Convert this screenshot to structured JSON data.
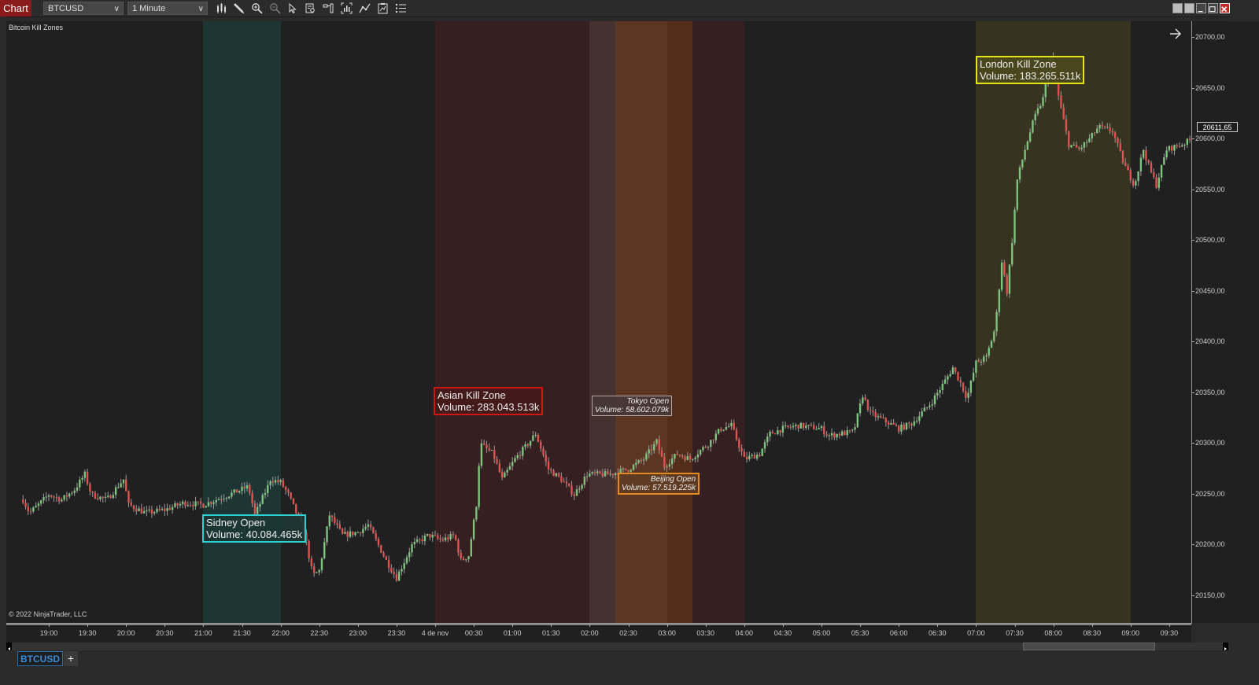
{
  "app": {
    "title": "Chart",
    "instrument": "BTCUSD",
    "interval": "1 Minute"
  },
  "toolbar": {
    "tools": [
      {
        "name": "bars-type",
        "icon": "candlestick-icon"
      },
      {
        "name": "drawing-tools",
        "icon": "pencil-icon"
      },
      {
        "name": "zoom-in",
        "icon": "zoom-in-icon"
      },
      {
        "name": "zoom-out",
        "icon": "zoom-out-icon"
      },
      {
        "name": "pointer",
        "icon": "cursor-icon"
      },
      {
        "name": "data-box",
        "icon": "data-box-icon"
      },
      {
        "name": "chart-trader",
        "icon": "chart-trader-icon"
      },
      {
        "name": "indicators",
        "icon": "indicators-icon"
      },
      {
        "name": "strategies",
        "icon": "strategies-icon"
      },
      {
        "name": "templates",
        "icon": "templates-icon"
      },
      {
        "name": "properties",
        "icon": "list-icon"
      }
    ]
  },
  "window_controls": [
    "link-button-1",
    "link-button-2",
    "minimize",
    "maximize",
    "close"
  ],
  "chart": {
    "title": "Bitcoin Kill Zones",
    "copyright": "© 2022 NinjaTrader, LLC",
    "current_price": "20611,65",
    "colors": {
      "up": "#7dc47d",
      "down": "#e0524f",
      "wick": "#9a9a9a",
      "background": "#202020"
    }
  },
  "chart_data": {
    "type": "candlestick",
    "title": "Bitcoin Kill Zones",
    "instrument": "BTCUSD",
    "interval": "1 Minute",
    "ylim": [
      20125,
      20717
    ],
    "yticks": [
      "20150,00",
      "20200,00",
      "20250,00",
      "20300,00",
      "20350,00",
      "20400,00",
      "20450,00",
      "20500,00",
      "20550,00",
      "20600,00",
      "20650,00",
      "20700,00"
    ],
    "ytick_values": [
      20150,
      20200,
      20250,
      20300,
      20350,
      20400,
      20450,
      20500,
      20550,
      20600,
      20650,
      20700
    ],
    "xticks": [
      "19:00",
      "19:30",
      "20:00",
      "20:30",
      "21:00",
      "21:30",
      "22:00",
      "22:30",
      "23:00",
      "23:30",
      "4 de nov",
      "00:30",
      "01:00",
      "01:30",
      "02:00",
      "02:30",
      "03:00",
      "03:30",
      "04:00",
      "04:30",
      "05:00",
      "05:30",
      "06:00",
      "06:30",
      "07:00",
      "07:30",
      "08:00",
      "08:30",
      "09:00",
      "09:30"
    ],
    "x_start_minutes_before_1900": 20,
    "x_end_minutes_after_1900": 880,
    "price_path": [
      [
        -20,
        20245
      ],
      [
        -15,
        20232
      ],
      [
        -8,
        20240
      ],
      [
        0,
        20250
      ],
      [
        10,
        20245
      ],
      [
        20,
        20255
      ],
      [
        28,
        20270
      ],
      [
        33,
        20250
      ],
      [
        45,
        20245
      ],
      [
        58,
        20265
      ],
      [
        62,
        20240
      ],
      [
        75,
        20232
      ],
      [
        90,
        20235
      ],
      [
        105,
        20242
      ],
      [
        120,
        20240
      ],
      [
        140,
        20250
      ],
      [
        155,
        20258
      ],
      [
        160,
        20230
      ],
      [
        170,
        20258
      ],
      [
        172,
        20265
      ],
      [
        180,
        20262
      ],
      [
        186,
        20250
      ],
      [
        198,
        20215
      ],
      [
        205,
        20170
      ],
      [
        210,
        20175
      ],
      [
        218,
        20230
      ],
      [
        228,
        20210
      ],
      [
        240,
        20213
      ],
      [
        248,
        20220
      ],
      [
        262,
        20185
      ],
      [
        270,
        20168
      ],
      [
        282,
        20200
      ],
      [
        295,
        20210
      ],
      [
        305,
        20205
      ],
      [
        315,
        20210
      ],
      [
        320,
        20185
      ],
      [
        326,
        20190
      ],
      [
        332,
        20240
      ],
      [
        335,
        20300
      ],
      [
        345,
        20290
      ],
      [
        352,
        20265
      ],
      [
        362,
        20285
      ],
      [
        372,
        20300
      ],
      [
        378,
        20310
      ],
      [
        388,
        20275
      ],
      [
        398,
        20265
      ],
      [
        408,
        20250
      ],
      [
        418,
        20270
      ],
      [
        435,
        20270
      ],
      [
        450,
        20275
      ],
      [
        462,
        20285
      ],
      [
        472,
        20302
      ],
      [
        478,
        20278
      ],
      [
        488,
        20290
      ],
      [
        498,
        20285
      ],
      [
        512,
        20300
      ],
      [
        522,
        20315
      ],
      [
        530,
        20318
      ],
      [
        540,
        20285
      ],
      [
        552,
        20290
      ],
      [
        560,
        20310
      ],
      [
        570,
        20315
      ],
      [
        582,
        20318
      ],
      [
        600,
        20315
      ],
      [
        605,
        20308
      ],
      [
        615,
        20310
      ],
      [
        625,
        20312
      ],
      [
        632,
        20348
      ],
      [
        638,
        20330
      ],
      [
        650,
        20322
      ],
      [
        660,
        20315
      ],
      [
        670,
        20320
      ],
      [
        685,
        20340
      ],
      [
        695,
        20360
      ],
      [
        702,
        20375
      ],
      [
        708,
        20360
      ],
      [
        713,
        20345
      ],
      [
        720,
        20380
      ],
      [
        728,
        20385
      ],
      [
        735,
        20415
      ],
      [
        740,
        20480
      ],
      [
        744,
        20450
      ],
      [
        748,
        20500
      ],
      [
        752,
        20560
      ],
      [
        758,
        20590
      ],
      [
        765,
        20620
      ],
      [
        772,
        20640
      ],
      [
        778,
        20680
      ],
      [
        786,
        20630
      ],
      [
        792,
        20595
      ],
      [
        800,
        20590
      ],
      [
        808,
        20600
      ],
      [
        815,
        20612
      ],
      [
        826,
        20608
      ],
      [
        835,
        20575
      ],
      [
        843,
        20555
      ],
      [
        850,
        20590
      ],
      [
        855,
        20570
      ],
      [
        860,
        20555
      ],
      [
        868,
        20590
      ],
      [
        880,
        20595
      ],
      [
        895,
        20605
      ],
      [
        910,
        20620
      ],
      [
        920,
        20625
      ],
      [
        926,
        20650
      ],
      [
        933,
        20620
      ],
      [
        945,
        20610
      ],
      [
        955,
        20625
      ],
      [
        965,
        20635
      ],
      [
        970,
        20648
      ],
      [
        978,
        20630
      ],
      [
        985,
        20610
      ],
      [
        992,
        20580
      ],
      [
        1000,
        20590
      ],
      [
        1008,
        20583
      ],
      [
        1014,
        20608
      ],
      [
        1020,
        20590
      ],
      [
        1028,
        20585
      ],
      [
        1035,
        20612
      ],
      [
        1040,
        20611.65
      ]
    ],
    "zones": [
      {
        "name": "Sidney Open",
        "start": "21:00",
        "end": "22:00",
        "volume": "40.084.465k",
        "fill": "#1d3634",
        "border": "#2fd0d0"
      },
      {
        "name": "Asian Kill Zone",
        "start": "00:00",
        "end": "04:00",
        "volume": "283.043.513k",
        "fill": "#361f20",
        "border": "#d01515"
      },
      {
        "name": "Tokyo Open",
        "start": "02:00",
        "end": "03:00",
        "volume": "58.602.079k",
        "fill": "rgba(90,70,70,0.45)",
        "border": "#b7a7a0"
      },
      {
        "name": "Beijing Open",
        "start": "02:20",
        "end": "03:20",
        "volume": "57.519.225k",
        "fill": "rgba(120,60,20,0.45)",
        "border": "#e38a20"
      },
      {
        "name": "London Kill Zone",
        "start": "07:00",
        "end": "09:00",
        "volume": "183.265.511k",
        "fill": "#363421",
        "border": "#e4e41c"
      }
    ]
  },
  "labels": {
    "sidney": {
      "title": "Sidney Open",
      "volume": "Volume: 40.084.465k"
    },
    "asian": {
      "title": "Asian Kill Zone",
      "volume": "Volume: 283.043.513k"
    },
    "tokyo": {
      "title": "Tokyo Open",
      "volume": "Volume: 58.602.079k"
    },
    "beijing": {
      "title": "Beijing Open",
      "volume": "Volume: 57.519.225k"
    },
    "london": {
      "title": "London Kill Zone",
      "volume": "Volume: 183.265.511k"
    }
  },
  "tabs": [
    {
      "label": "BTCUSD",
      "active": true
    }
  ],
  "tab_add_label": "+"
}
